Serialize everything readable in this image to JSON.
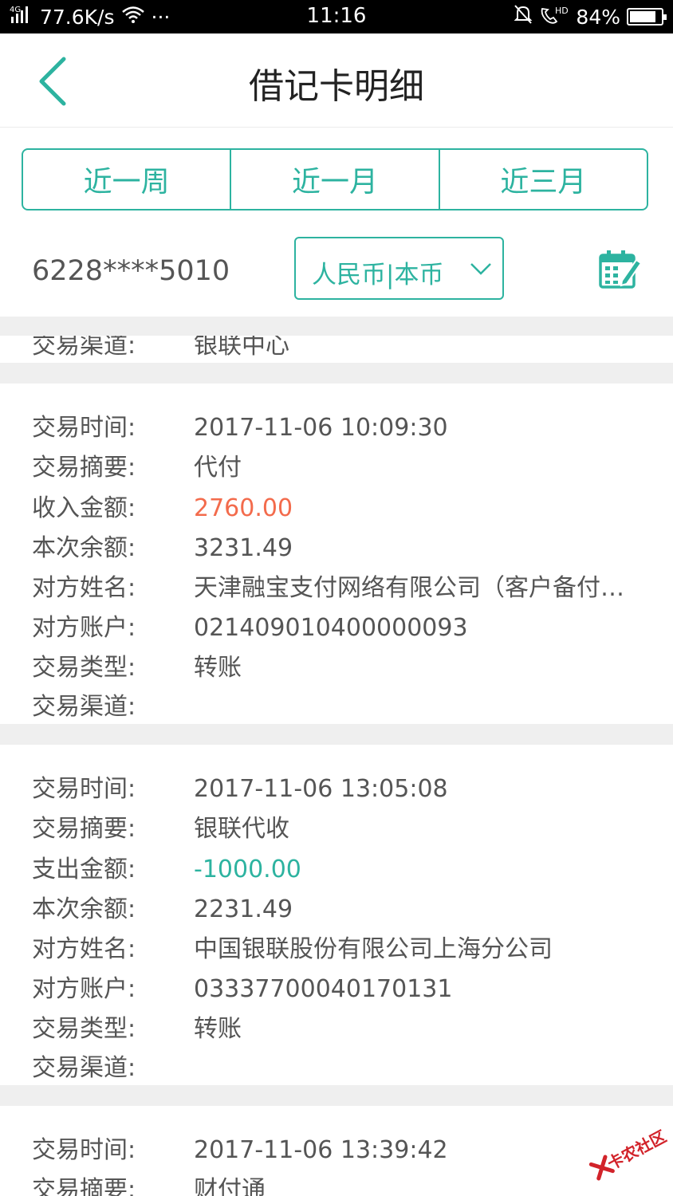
{
  "status_bar": {
    "network": "4G",
    "speed": "77.6K/s",
    "dots": "···",
    "time": "11:16",
    "hd": "HD",
    "battery": "84%",
    "battery_level": 0.84
  },
  "header": {
    "title": "借记卡明细"
  },
  "tabs": [
    {
      "label": "近一周"
    },
    {
      "label": "近一月"
    },
    {
      "label": "近三月"
    }
  ],
  "account": {
    "card_number": "6228****5010",
    "currency": "人民币|本币"
  },
  "partial_record": {
    "channel_label": "交易渠道:",
    "channel_value": "银联中心"
  },
  "records": [
    {
      "time_label": "交易时间:",
      "time": "2017-11-06 10:09:30",
      "summary_label": "交易摘要:",
      "summary": "代付",
      "amount_label": "收入金额:",
      "amount": "2760.00",
      "balance_label": "本次余额:",
      "balance": "3231.49",
      "party_label": "对方姓名:",
      "party": "天津融宝支付网络有限公司（客户备付金）",
      "account_label": "对方账户:",
      "account": "021409010400000093",
      "type_label": "交易类型:",
      "type": "转账",
      "channel_label": "交易渠道:",
      "channel": ""
    },
    {
      "time_label": "交易时间:",
      "time": "2017-11-06 13:05:08",
      "summary_label": "交易摘要:",
      "summary": "银联代收",
      "amount_label": "支出金额:",
      "amount": "-1000.00",
      "balance_label": "本次余额:",
      "balance": "2231.49",
      "party_label": "对方姓名:",
      "party": "中国银联股份有限公司上海分公司",
      "account_label": "对方账户:",
      "account": "03337700040170131",
      "type_label": "交易类型:",
      "type": "转账",
      "channel_label": "交易渠道:",
      "channel": ""
    },
    {
      "time_label": "交易时间:",
      "time": "2017-11-06 13:39:42",
      "summary_label": "交易摘要:",
      "summary": "财付通"
    }
  ],
  "watermark": "卡农社区",
  "colors": {
    "accent": "#2db3a0",
    "income": "#f36b4c",
    "separator": "#efefef"
  }
}
